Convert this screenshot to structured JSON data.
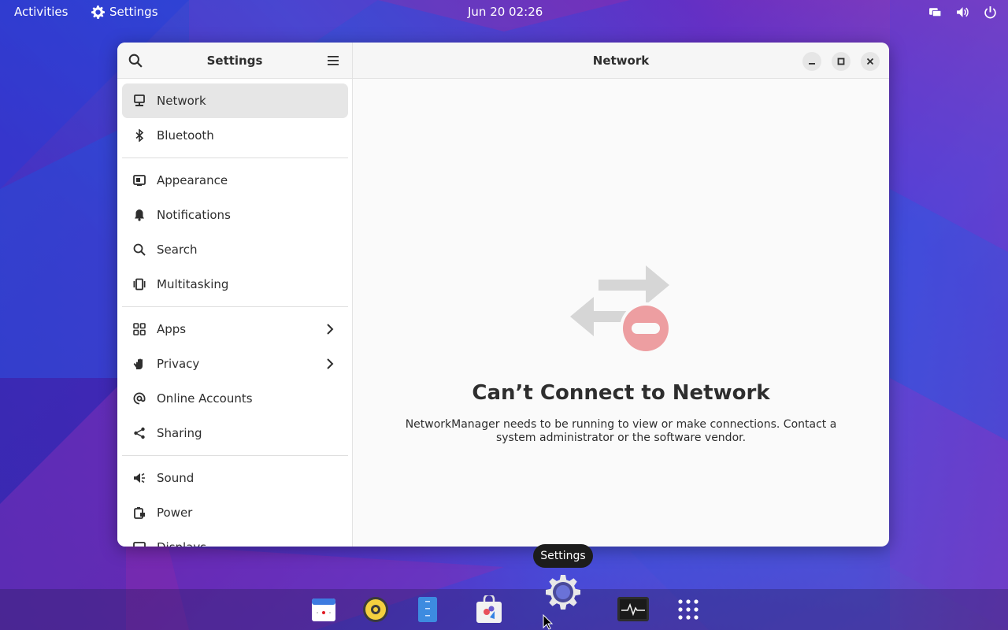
{
  "topbar": {
    "activities": "Activities",
    "app_name": "Settings",
    "clock": "Jun 20  02:26"
  },
  "window": {
    "sidebar_title": "Settings",
    "content_title": "Network"
  },
  "sidebar": {
    "groups": [
      [
        {
          "label": "Network",
          "icon": "network-wired-icon",
          "active": true
        },
        {
          "label": "Bluetooth",
          "icon": "bluetooth-icon"
        }
      ],
      [
        {
          "label": "Appearance",
          "icon": "appearance-icon"
        },
        {
          "label": "Notifications",
          "icon": "bell-icon"
        },
        {
          "label": "Search",
          "icon": "search-icon"
        },
        {
          "label": "Multitasking",
          "icon": "multitasking-icon"
        }
      ],
      [
        {
          "label": "Apps",
          "icon": "apps-grid-icon",
          "chevron": true
        },
        {
          "label": "Privacy",
          "icon": "hand-icon",
          "chevron": true
        },
        {
          "label": "Online Accounts",
          "icon": "at-sign-icon"
        },
        {
          "label": "Sharing",
          "icon": "share-icon"
        }
      ],
      [
        {
          "label": "Sound",
          "icon": "speaker-icon"
        },
        {
          "label": "Power",
          "icon": "battery-icon"
        },
        {
          "label": "Displays",
          "icon": "display-icon"
        }
      ]
    ]
  },
  "status": {
    "title": "Can’t Connect to Network",
    "description": "NetworkManager needs to be running to view or make connections. Contact a system administrator or the software vendor."
  },
  "tooltip": "Settings",
  "colors": {
    "accent_error": "#e01b24",
    "window_bg": "#fafafa",
    "sidebar_active": "#e6e6e6"
  }
}
